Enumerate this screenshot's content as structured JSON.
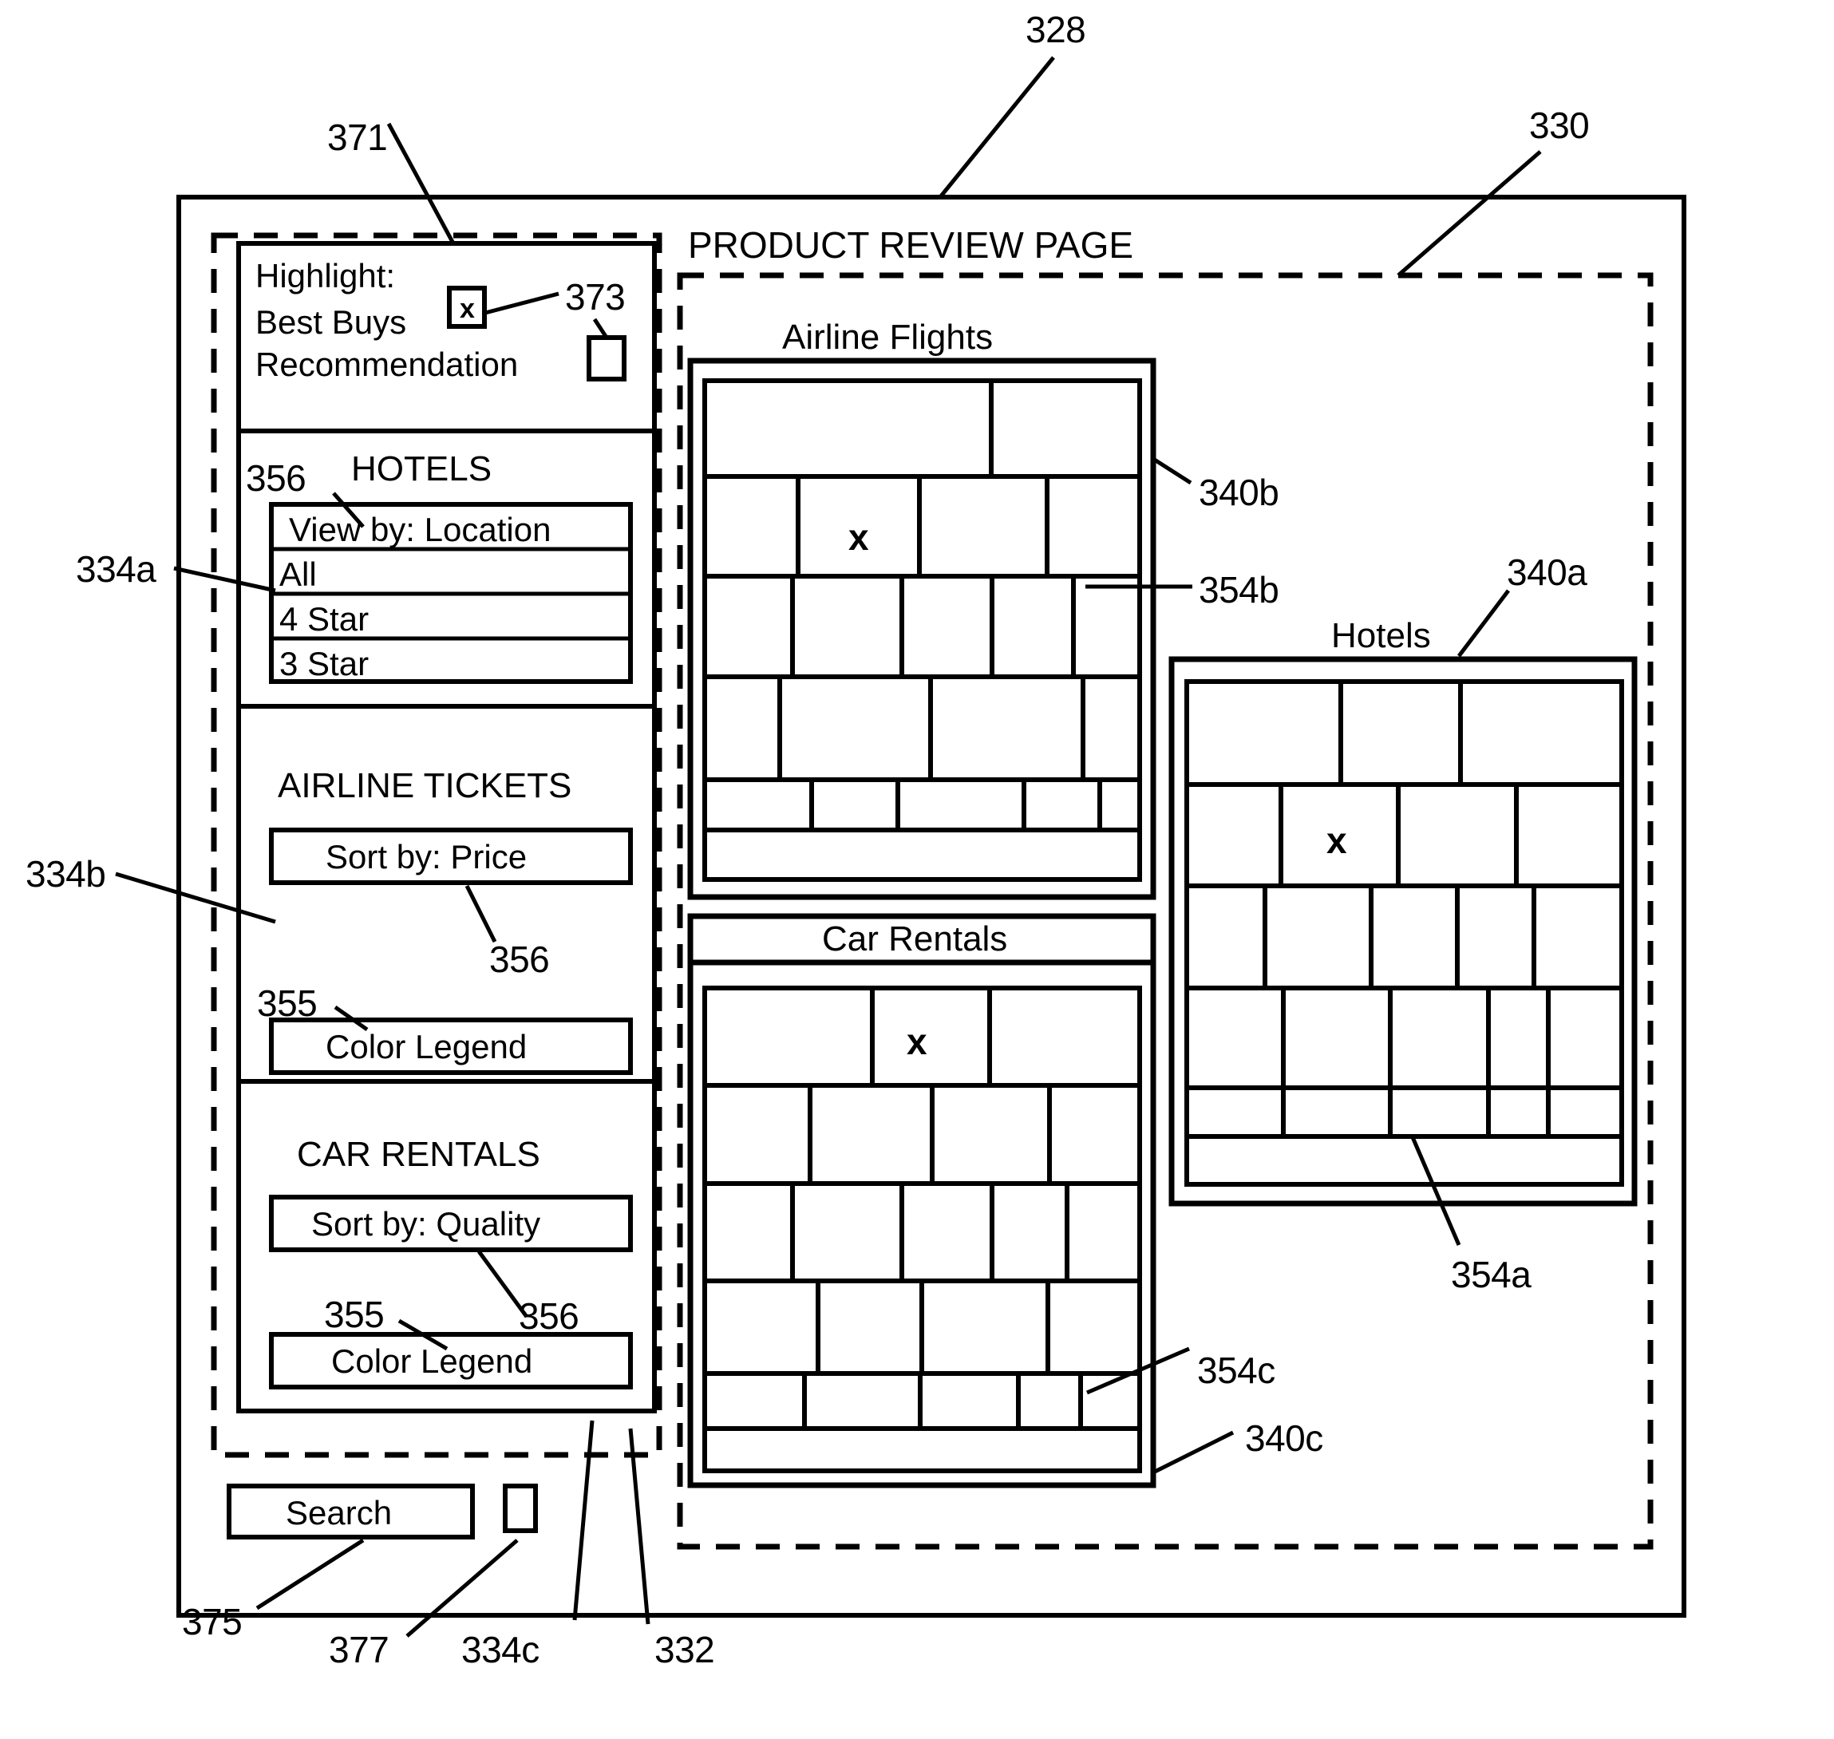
{
  "figure": {
    "page_title": "PRODUCT REVIEW PAGE",
    "reference_numerals": [
      {
        "id": "328",
        "text": "328"
      },
      {
        "id": "330",
        "text": "330"
      },
      {
        "id": "371",
        "text": "371"
      },
      {
        "id": "373",
        "text": "373"
      },
      {
        "id": "334a",
        "text": "334a"
      },
      {
        "id": "334b",
        "text": "334b"
      },
      {
        "id": "334c",
        "text": "334c"
      },
      {
        "id": "332",
        "text": "332"
      },
      {
        "id": "375",
        "text": "375"
      },
      {
        "id": "377",
        "text": "377"
      },
      {
        "id": "355a",
        "text": "355"
      },
      {
        "id": "355b",
        "text": "355"
      },
      {
        "id": "356a",
        "text": "356"
      },
      {
        "id": "356b",
        "text": "356"
      },
      {
        "id": "356c",
        "text": "356"
      },
      {
        "id": "340a",
        "text": "340a"
      },
      {
        "id": "340b",
        "text": "340b"
      },
      {
        "id": "340c",
        "text": "340c"
      },
      {
        "id": "354a",
        "text": "354a"
      },
      {
        "id": "354b",
        "text": "354b"
      },
      {
        "id": "354c",
        "text": "354c"
      }
    ]
  },
  "controls": {
    "highlight": {
      "heading": "Highlight:",
      "best_buys_label": "Best Buys",
      "best_buys_checked_mark": "x",
      "recommendation_label": "Recommendation",
      "recommendation_checked_mark": ""
    },
    "hotels_panel": {
      "title": "HOTELS",
      "view_by": "View by: Location",
      "options": [
        "All",
        "4 Star",
        "3 Star"
      ]
    },
    "airline_panel": {
      "title": "AIRLINE TICKETS",
      "sort_by": "Sort by: Price",
      "color_legend": "Color Legend"
    },
    "car_panel": {
      "title": "CAR RENTALS",
      "sort_by": "Sort by: Quality",
      "color_legend": "Color Legend"
    },
    "search": {
      "button_label": "Search",
      "checkbox_mark": ""
    }
  },
  "treemaps": [
    {
      "id": "airline-flights",
      "title": "Airline Flights",
      "marked_cell_label": "x"
    },
    {
      "id": "hotels",
      "title": "Hotels",
      "marked_cell_label": "x"
    },
    {
      "id": "car-rentals",
      "title": "Car Rentals",
      "marked_cell_label": "x"
    }
  ]
}
